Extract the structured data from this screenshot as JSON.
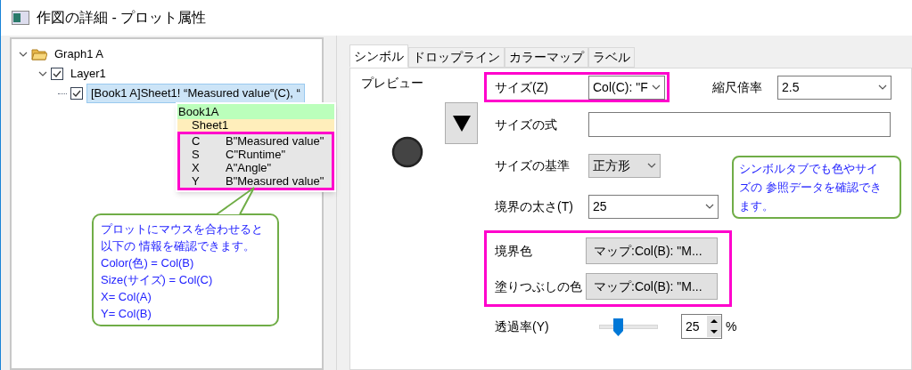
{
  "window": {
    "title": "作図の詳細 - プロット属性"
  },
  "tree": [
    {
      "label": "Graph1 A",
      "kind": "folder",
      "expanded": true,
      "children": [
        {
          "label": "Layer1",
          "kind": "check",
          "checked": true,
          "expanded": true,
          "children": [
            {
              "label": "[Book1 A]Sheet1! “Measured value“(C), “",
              "kind": "check",
              "checked": true,
              "selected": true
            }
          ]
        }
      ]
    }
  ],
  "hover_info": {
    "book": "Book1A",
    "sheet": "Sheet1",
    "highlighted": true,
    "rows": [
      {
        "key": "C",
        "value": "B\"Measured value\""
      },
      {
        "key": "S",
        "value": "C\"Runtime\""
      },
      {
        "key": "X",
        "value": "A\"Angle\""
      },
      {
        "key": "Y",
        "value": "B\"Measured value\""
      }
    ]
  },
  "callouts": [
    {
      "lines": [
        "プロットにマウスを合わせると",
        "以下の 情報を確認できます。",
        "Color(色) = Col(B)",
        "Size(サイズ) = Col(C)",
        "X= Col(A)",
        "Y= Col(B)"
      ]
    },
    {
      "lines": [
        "シンボルタブでも色やサイ",
        "ズの 参照データを確認でき",
        "ます。"
      ]
    }
  ],
  "tabs": [
    {
      "label": "シンボル",
      "selected": true
    },
    {
      "label": "ドロップライン",
      "selected": false
    },
    {
      "label": "カラーマップ",
      "selected": false
    },
    {
      "label": "ラベル",
      "selected": false
    }
  ],
  "symbol_tab": {
    "preview_label": "プレビュー",
    "size": {
      "label": "サイズ(Z)",
      "value": "Col(C): \"F",
      "highlighted": true
    },
    "scale": {
      "label": "縮尺倍率",
      "value": "2.5"
    },
    "expression": {
      "label": "サイズの式"
    },
    "basis": {
      "label": "サイズの基準",
      "value": "正方形"
    },
    "border_width": {
      "label": "境界の太さ(T)",
      "value": "25"
    },
    "colors": {
      "highlighted": true,
      "items": [
        {
          "label": "境界色",
          "value": "マップ:Col(B): \"M..."
        },
        {
          "label": "塗りつぶしの色",
          "value": "マップ:Col(B): \"M..."
        }
      ]
    },
    "transparency": {
      "label": "透過率(Y)",
      "level": 0.3,
      "value": "25",
      "unit": "%"
    }
  }
}
